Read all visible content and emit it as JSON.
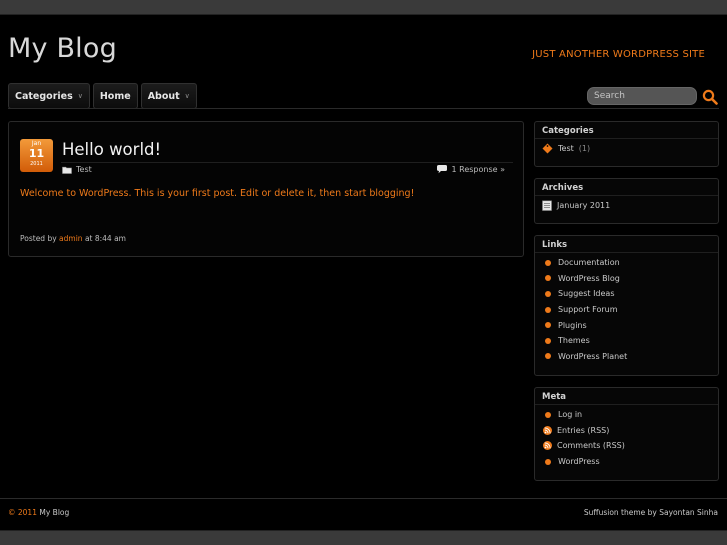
{
  "site": {
    "title": "My Blog",
    "tagline": "JUST ANOTHER WORDPRESS SITE"
  },
  "nav": {
    "items": [
      {
        "label": "Categories",
        "has_dropdown": true
      },
      {
        "label": "Home",
        "has_dropdown": false
      },
      {
        "label": "About",
        "has_dropdown": true
      }
    ],
    "chevron": "»"
  },
  "search": {
    "placeholder": "Search",
    "icon": "search-icon"
  },
  "post": {
    "date": {
      "month": "Jan",
      "day": "11",
      "year": "2011"
    },
    "title": "Hello world!",
    "category": "Test",
    "responses": "1 Response »",
    "body": "Welcome to WordPress. This is your first post. Edit or delete it, then start blogging!",
    "footer": {
      "prefix": "Posted by",
      "author": "admin",
      "suffix": "at 8:44 am"
    }
  },
  "sidebar": {
    "categories": {
      "title": "Categories",
      "items": [
        {
          "label": "Test",
          "count": "(1)"
        }
      ]
    },
    "archives": {
      "title": "Archives",
      "items": [
        {
          "label": "January 2011"
        }
      ]
    },
    "links": {
      "title": "Links",
      "items": [
        {
          "label": "Documentation"
        },
        {
          "label": "WordPress Blog"
        },
        {
          "label": "Suggest Ideas"
        },
        {
          "label": "Support Forum"
        },
        {
          "label": "Plugins"
        },
        {
          "label": "Themes"
        },
        {
          "label": "WordPress Planet"
        }
      ]
    },
    "meta": {
      "title": "Meta",
      "items": [
        {
          "label": "Log in",
          "icon": "bullet"
        },
        {
          "label": "Entries (RSS)",
          "icon": "rss"
        },
        {
          "label": "Comments (RSS)",
          "icon": "rss"
        },
        {
          "label": "WordPress",
          "icon": "bullet"
        }
      ]
    }
  },
  "footer": {
    "year": "© 2011",
    "site": "My Blog",
    "credit": "Suffusion theme by Sayontan Sinha"
  },
  "colors": {
    "accent": "#ef7a1a",
    "background": "#000000",
    "page_bg": "#3a3a3a"
  }
}
